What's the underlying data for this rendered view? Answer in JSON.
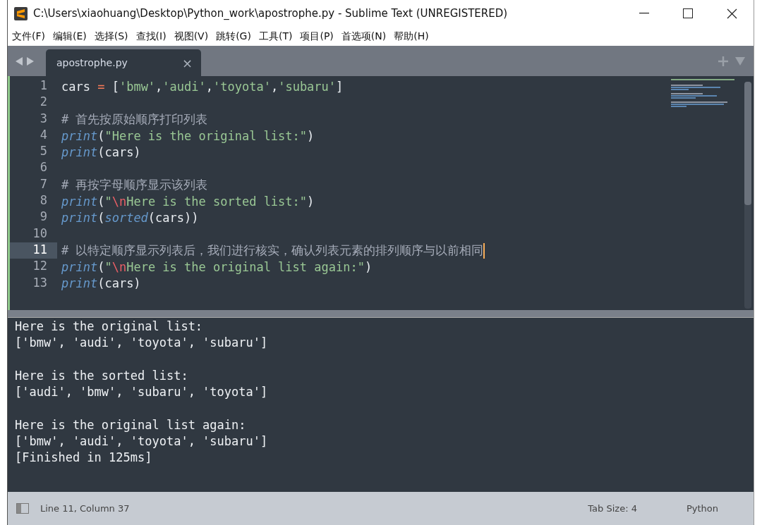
{
  "window": {
    "title": "C:\\Users\\xiaohuang\\Desktop\\Python_work\\apostrophe.py - Sublime Text (UNREGISTERED)"
  },
  "menu": [
    "文件(F)",
    "编辑(E)",
    "选择(S)",
    "查找(I)",
    "视图(V)",
    "跳转(G)",
    "工具(T)",
    "项目(P)",
    "首选项(N)",
    "帮助(H)"
  ],
  "tabs": [
    {
      "label": "apostrophe.py",
      "selected": true,
      "close": "×"
    }
  ],
  "editor": {
    "lines": [
      {
        "number": "1",
        "current": false,
        "tokens": [
          {
            "kind": "plain",
            "text": "cars "
          },
          {
            "kind": "operator",
            "text": "="
          },
          {
            "kind": "plain",
            "text": " ["
          },
          {
            "kind": "string",
            "text": "'bmw'"
          },
          {
            "kind": "plain",
            "text": ","
          },
          {
            "kind": "string",
            "text": "'audi'"
          },
          {
            "kind": "plain",
            "text": ","
          },
          {
            "kind": "string",
            "text": "'toyota'"
          },
          {
            "kind": "plain",
            "text": ","
          },
          {
            "kind": "string",
            "text": "'subaru'"
          },
          {
            "kind": "plain",
            "text": "]"
          }
        ]
      },
      {
        "number": "2",
        "current": false
      },
      {
        "number": "3",
        "current": false,
        "tokens": [
          {
            "kind": "comment",
            "text": "# 首先按原始顺序打印列表"
          }
        ]
      },
      {
        "number": "4",
        "current": false,
        "tokens": [
          {
            "kind": "func",
            "text": "print"
          },
          {
            "kind": "plain",
            "text": "("
          },
          {
            "kind": "string",
            "text": "\"Here is the original list:\""
          },
          {
            "kind": "plain",
            "text": ")"
          }
        ]
      },
      {
        "number": "5",
        "current": false,
        "tokens": [
          {
            "kind": "func",
            "text": "print"
          },
          {
            "kind": "plain",
            "text": "(cars)"
          }
        ]
      },
      {
        "number": "6",
        "current": false
      },
      {
        "number": "7",
        "current": false,
        "tokens": [
          {
            "kind": "comment",
            "text": "# 再按字母顺序显示该列表"
          }
        ]
      },
      {
        "number": "8",
        "current": false,
        "tokens": [
          {
            "kind": "func",
            "text": "print"
          },
          {
            "kind": "plain",
            "text": "("
          },
          {
            "kind": "string",
            "text": "\""
          },
          {
            "kind": "escape",
            "text": "\\n"
          },
          {
            "kind": "string",
            "text": "Here is the sorted list:\""
          },
          {
            "kind": "plain",
            "text": ")"
          }
        ]
      },
      {
        "number": "9",
        "current": false,
        "tokens": [
          {
            "kind": "func",
            "text": "print"
          },
          {
            "kind": "plain",
            "text": "("
          },
          {
            "kind": "func",
            "text": "sorted"
          },
          {
            "kind": "plain",
            "text": "(cars))"
          }
        ]
      },
      {
        "number": "10",
        "current": false
      },
      {
        "number": "11",
        "current": true,
        "tokens": [
          {
            "kind": "comment",
            "text": "# 以特定顺序显示列表后，我们进行核实，确认列表元素的排列顺序与以前相同"
          }
        ]
      },
      {
        "number": "12",
        "current": false,
        "tokens": [
          {
            "kind": "func",
            "text": "print"
          },
          {
            "kind": "plain",
            "text": "("
          },
          {
            "kind": "string",
            "text": "\""
          },
          {
            "kind": "escape",
            "text": "\\n"
          },
          {
            "kind": "string",
            "text": "Here is the original list again:\""
          },
          {
            "kind": "plain",
            "text": ")"
          }
        ]
      },
      {
        "number": "13",
        "current": false,
        "tokens": [
          {
            "kind": "func",
            "text": "print"
          },
          {
            "kind": "plain",
            "text": "(cars)"
          }
        ]
      }
    ]
  },
  "output": [
    [
      "Here is the original list:",
      "['bmw', 'audi', 'toyota', 'subaru']"
    ],
    [
      "Here is the sorted list:",
      "['audi', 'bmw', 'subaru', 'toyota']"
    ],
    [
      "Here is the original list again:",
      "['bmw', 'audi', 'toyota', 'subaru']",
      "[Finished in 125ms]"
    ]
  ],
  "status_bar": {
    "position": "Line 11, Column 37",
    "tab_size": "Tab Size: 4",
    "syntax": "Python"
  }
}
